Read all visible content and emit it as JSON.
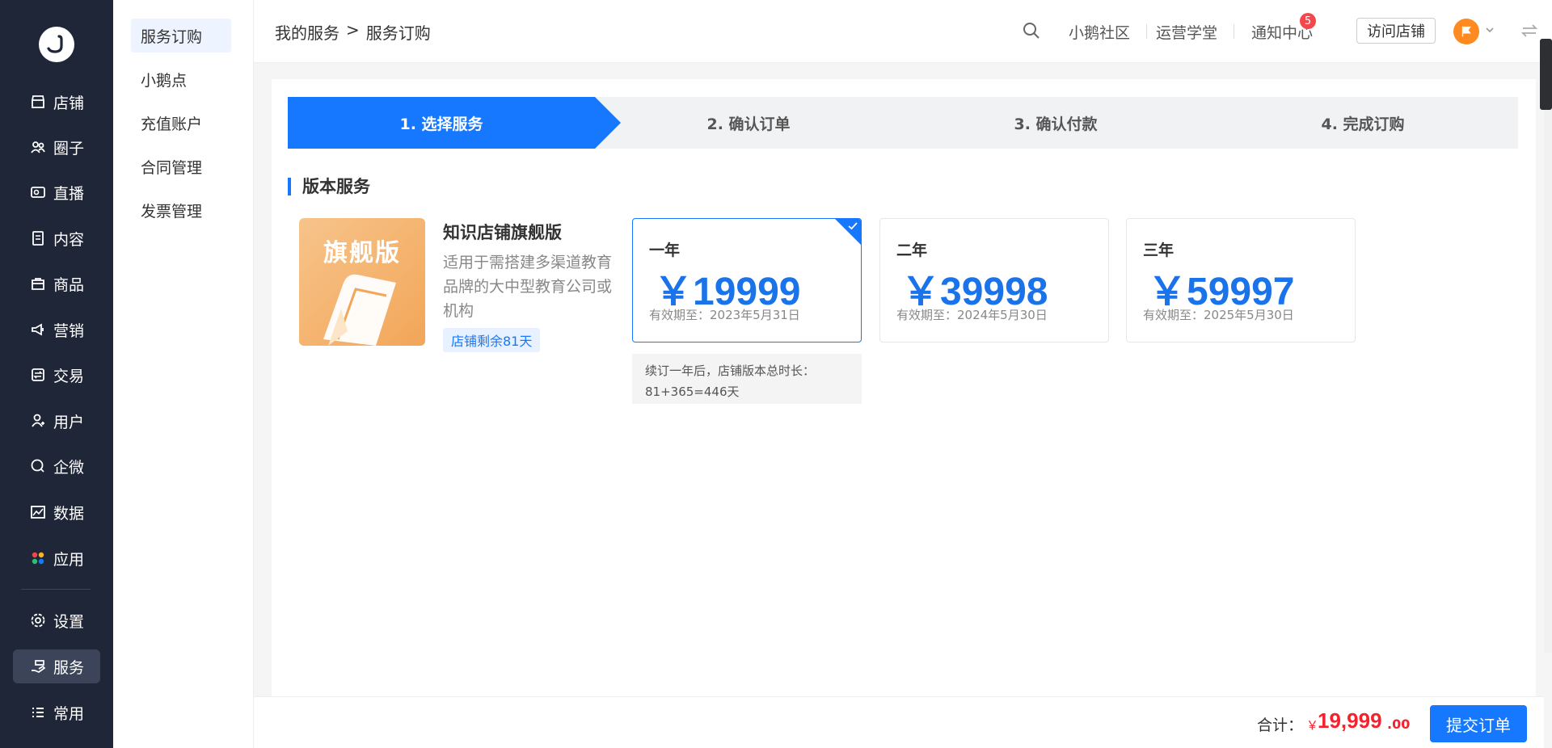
{
  "nav": {
    "items": [
      {
        "label": "店铺",
        "icon": "store-icon"
      },
      {
        "label": "圈子",
        "icon": "group-icon"
      },
      {
        "label": "直播",
        "icon": "live-icon"
      },
      {
        "label": "内容",
        "icon": "content-icon"
      },
      {
        "label": "商品",
        "icon": "goods-icon"
      },
      {
        "label": "营销",
        "icon": "megaphone-icon"
      },
      {
        "label": "交易",
        "icon": "exchange-icon"
      },
      {
        "label": "用户",
        "icon": "user-icon"
      },
      {
        "label": "企微",
        "icon": "chat-icon"
      },
      {
        "label": "数据",
        "icon": "chart-icon"
      },
      {
        "label": "应用",
        "icon": "apps-icon"
      }
    ],
    "bottom": [
      {
        "label": "设置",
        "icon": "gear-icon"
      },
      {
        "label": "服务",
        "icon": "service-icon"
      },
      {
        "label": "常用",
        "icon": "list-icon"
      }
    ]
  },
  "submenu": [
    "服务订购",
    "小鹅点",
    "充值账户",
    "合同管理",
    "发票管理"
  ],
  "header": {
    "crumb_parent": "我的服务",
    "crumb_sep": ">",
    "crumb_current": "服务订购",
    "links": [
      "小鹅社区",
      "运营学堂",
      "通知中心"
    ],
    "notify_count": "5",
    "visit_store": "访问店铺"
  },
  "steps": [
    "1. 选择服务",
    "2. 确认订单",
    "3. 确认付款",
    "4. 完成订购"
  ],
  "section_title": "版本服务",
  "product": {
    "thumb_text": "旗舰版",
    "name": "知识店铺旗舰版",
    "desc": "适用于需搭建多渠道教育品牌的大中型教育公司或机构",
    "remain": "店铺剩余81天"
  },
  "plans": [
    {
      "duration": "一年",
      "price": "￥19999",
      "expiry": "有效期至：2023年5月31日",
      "selected": true
    },
    {
      "duration": "二年",
      "price": "￥39998",
      "expiry": "有效期至：2024年5月30日",
      "selected": false
    },
    {
      "duration": "三年",
      "price": "￥59997",
      "expiry": "有效期至：2025年5月30日",
      "selected": false
    }
  ],
  "renew_note": {
    "line1": "续订一年后，店铺版本总时长：",
    "line2": "81+365=446天"
  },
  "footer": {
    "total_label": "合计：",
    "currency": "￥",
    "total_int": "19,999",
    "total_dec": ".00",
    "submit": "提交订单"
  },
  "colors": {
    "accent": "#1677ff",
    "price": "#f5222d",
    "sidebar": "#1f2638"
  }
}
